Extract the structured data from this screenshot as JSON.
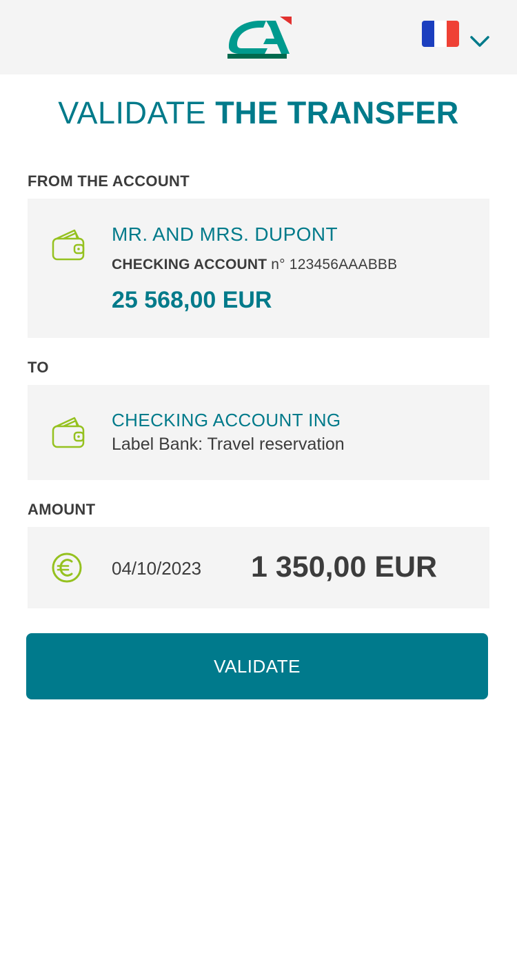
{
  "header": {
    "logo_text": "CA",
    "logo_icon": "ca-logo-icon",
    "language_flag_icon": "france-flag-icon",
    "language_chevron_icon": "chevron-down-icon"
  },
  "title": {
    "light": "VALIDATE",
    "bold": "THE TRANSFER"
  },
  "from": {
    "section_label": "FROM THE ACCOUNT",
    "icon": "wallet-icon",
    "owner": "MR. AND MRS. DUPONT",
    "account_type": "CHECKING ACCOUNT",
    "account_number": "n° 123456AAABBB",
    "balance": "25 568,00 EUR"
  },
  "to": {
    "section_label": "TO",
    "icon": "wallet-icon",
    "name": "CHECKING ACCOUNT ING",
    "label": "Label Bank: Travel reservation"
  },
  "amount": {
    "section_label": "AMOUNT",
    "icon": "euro-icon",
    "date": "04/10/2023",
    "value": "1 350,00 EUR"
  },
  "actions": {
    "validate_label": "VALIDATE"
  },
  "colors": {
    "accent": "#007a8a",
    "icon_green": "#95c11f",
    "card_bg": "#f4f4f4",
    "logo_red": "#e2312f",
    "logo_teal": "#009a8e",
    "logo_dark": "#006a4e",
    "flag_blue": "#1c3fbf",
    "flag_white": "#ffffff",
    "flag_red": "#ef4135"
  }
}
